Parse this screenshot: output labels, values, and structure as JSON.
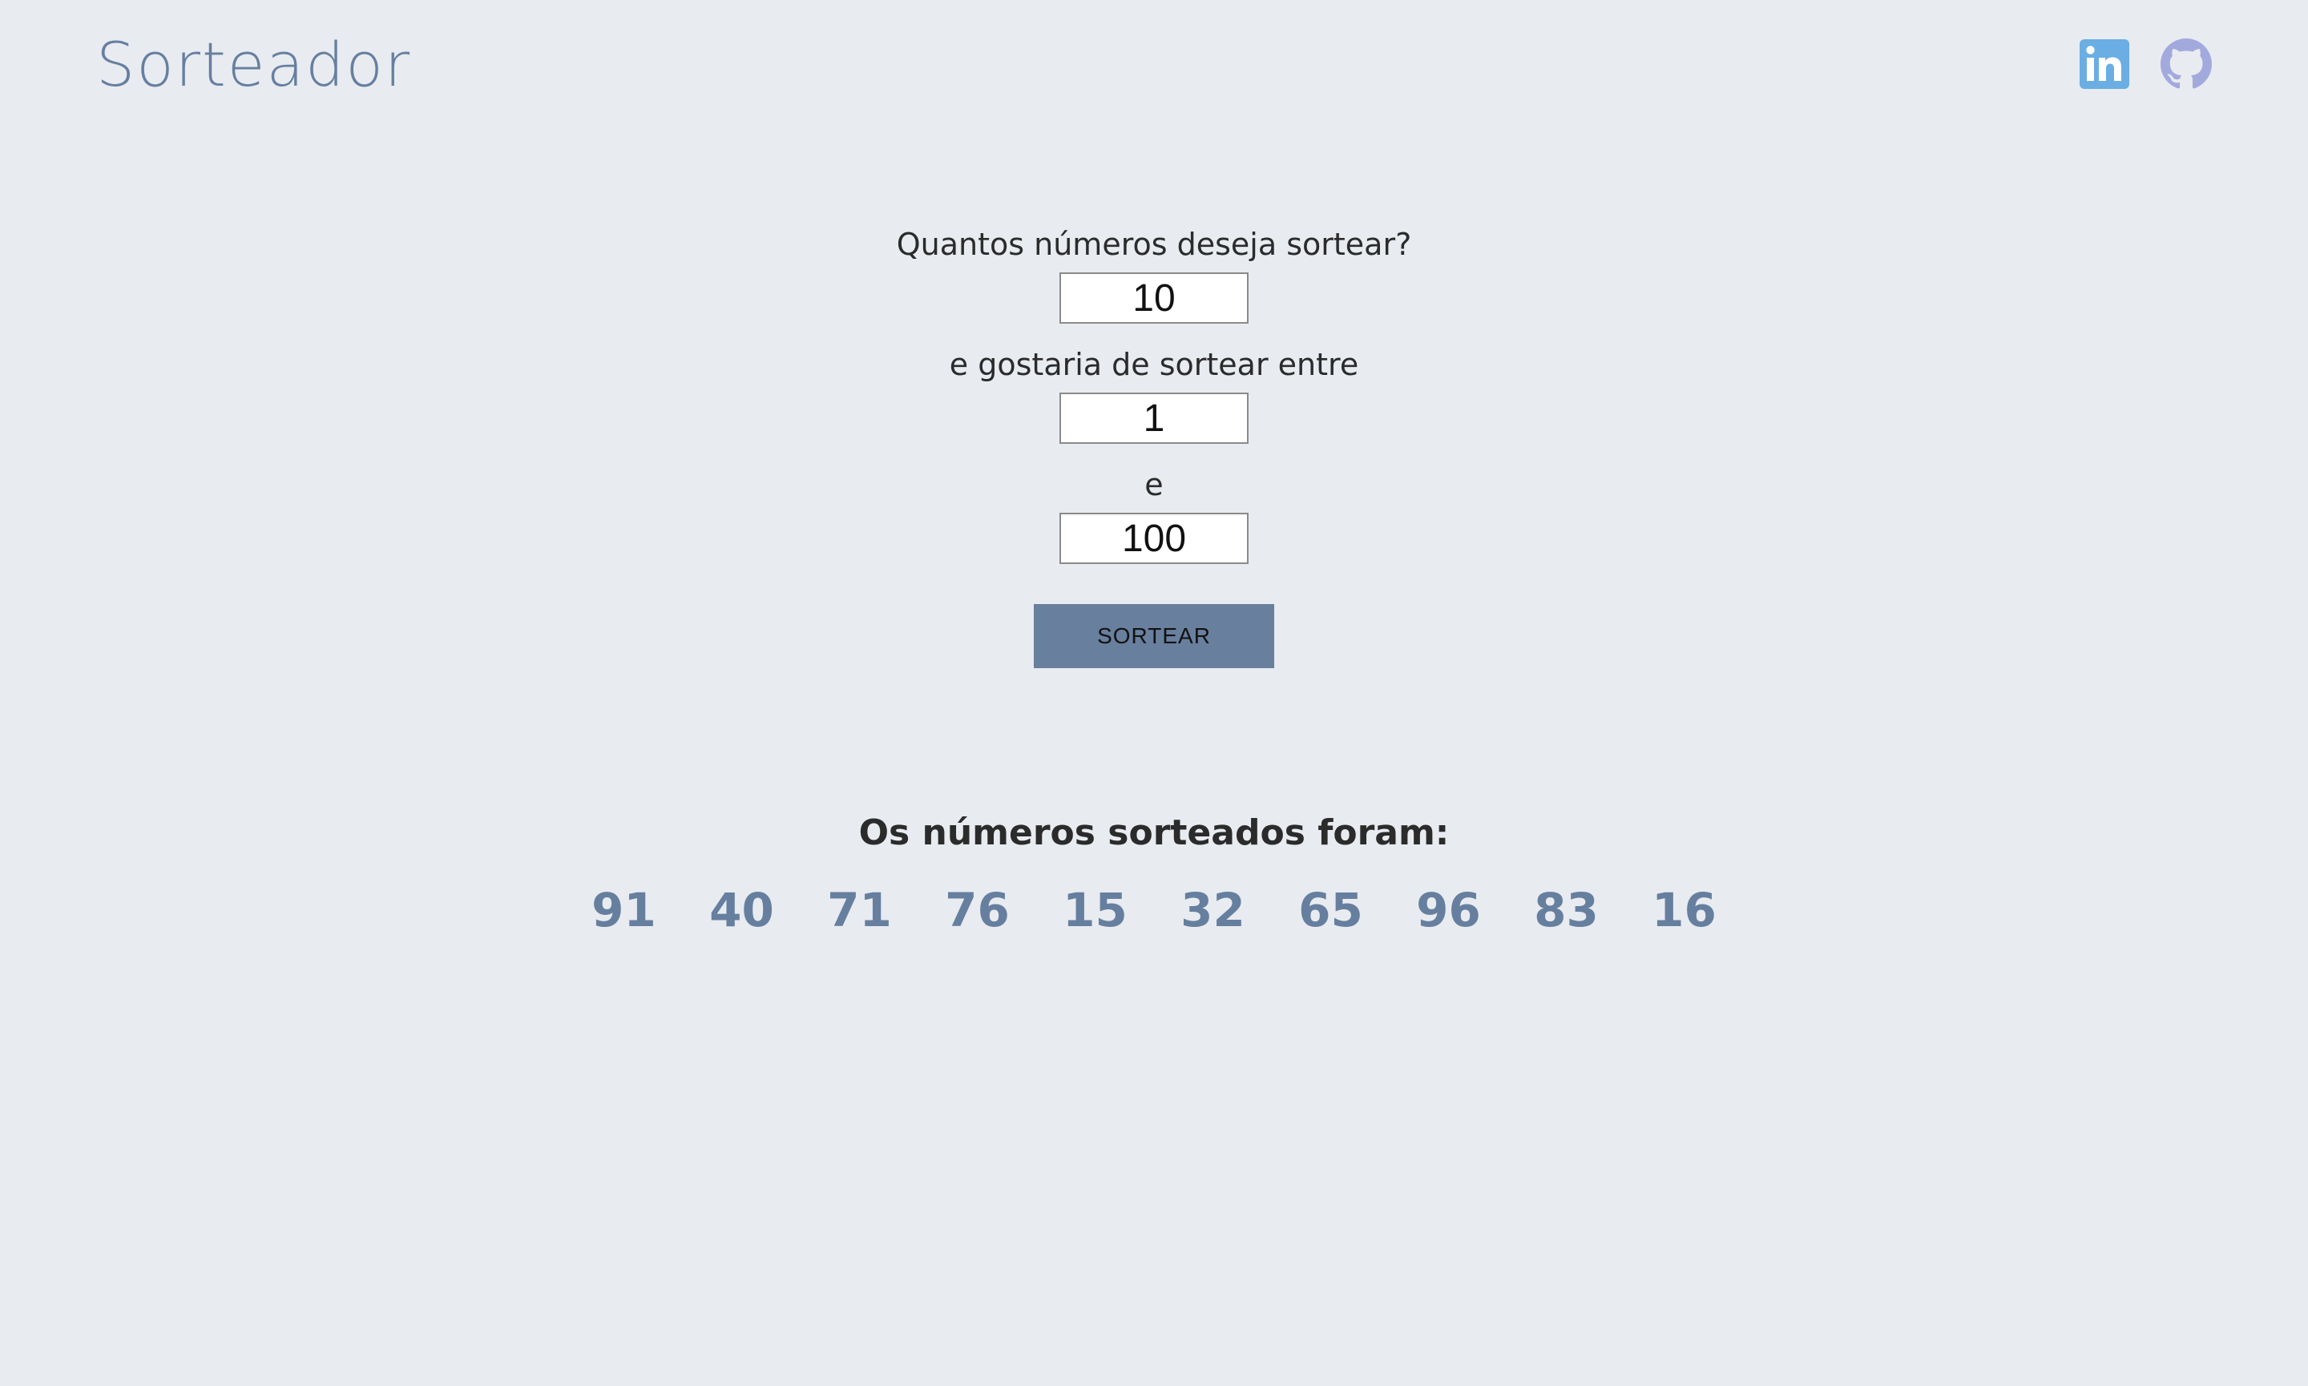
{
  "header": {
    "brand": "Sorteador",
    "links": [
      {
        "name": "linkedin-icon",
        "color": "#6aaee3"
      },
      {
        "name": "github-icon",
        "color": "#a2a9dd"
      }
    ]
  },
  "form": {
    "question": "Quantos números deseja sortear?",
    "quantity_value": "10",
    "range_label": "e gostaria de sortear entre",
    "from_value": "1",
    "connector": "e",
    "to_value": "100",
    "button_label": "SORTEAR"
  },
  "results": {
    "title": "Os números sorteados foram:",
    "numbers": [
      "91",
      "40",
      "71",
      "76",
      "15",
      "32",
      "65",
      "96",
      "83",
      "16"
    ]
  },
  "colors": {
    "background": "#e8ebf0",
    "accent": "#667f9f",
    "button": "#687f9e"
  }
}
